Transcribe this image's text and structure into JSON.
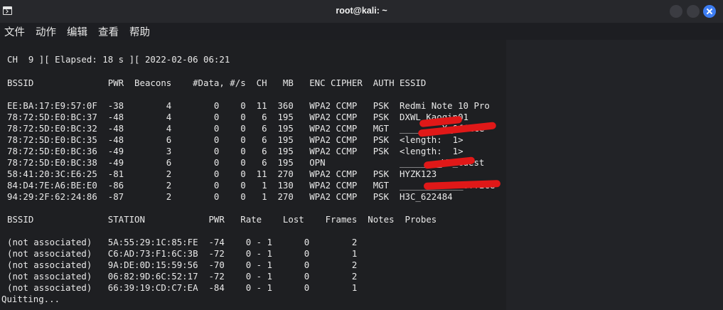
{
  "window": {
    "title": "root@kali: ~"
  },
  "menu": [
    "文件",
    "动作",
    "编辑",
    "查看",
    "帮助"
  ],
  "terminal": {
    "lines": [
      "CH  9 ][ Elapsed: 18 s ][ 2022-02-06 06:21",
      "BSSID              PWR  Beacons    #Data, #/s  CH   MB   ENC CIPHER  AUTH ESSID",
      "EE:BA:17:E9:57:0F  -38        4        0    0  11  360   WPA2 CCMP   PSK  Redmi Note 10 Pro",
      "78:72:5D:E0:BC:37  -48        4        0    0   6  195   WPA2 CCMP   PSK  DXWL_Kaoqin01",
      "78:72:5D:E0:BC:32  -48        4        0    0   6  195   WPA2 CCMP   MGT  ________X_Office",
      "78:72:5D:E0:BC:35  -48        6        0    0   6  195   WPA2 CCMP   PSK  <length:  1>",
      "78:72:5D:E0:BC:36  -49        3        0    0   6  195   WPA2 CCMP   PSK  <length:  1>",
      "78:72:5D:E0:BC:38  -49        6        0    0   6  195   OPN              ________WX_Guest",
      "58:41:20:3C:E6:25  -81        2        0    0  11  270   WPA2 CCMP   PSK  HYZK123",
      "84:D4:7E:A6:BE:E0  -86        2        0    0   1  130   WPA2 CCMP   MGT  ____________Office",
      "94:29:2F:62:24:86  -87        2        0    0   1  270   WPA2 CCMP   PSK  H3C_622484",
      "BSSID              STATION            PWR   Rate    Lost    Frames  Notes  Probes",
      "(not associated)   5A:55:29:1C:85:FE  -74    0 - 1      0        2",
      "(not associated)   C6:AD:73:F1:6C:3B  -72    0 - 1      0        1",
      "(not associated)   9A:DE:0D:15:59:56  -70    0 - 1      0        2",
      "(not associated)   06:82:9D:6C:52:17  -72    0 - 1      0        2",
      "(not associated)   66:39:19:CD:C7:EA  -84    0 - 1      0        1",
      "Quitting..."
    ]
  },
  "colors": {
    "redaction": "#e01818",
    "close_button": "#3d7df2"
  }
}
